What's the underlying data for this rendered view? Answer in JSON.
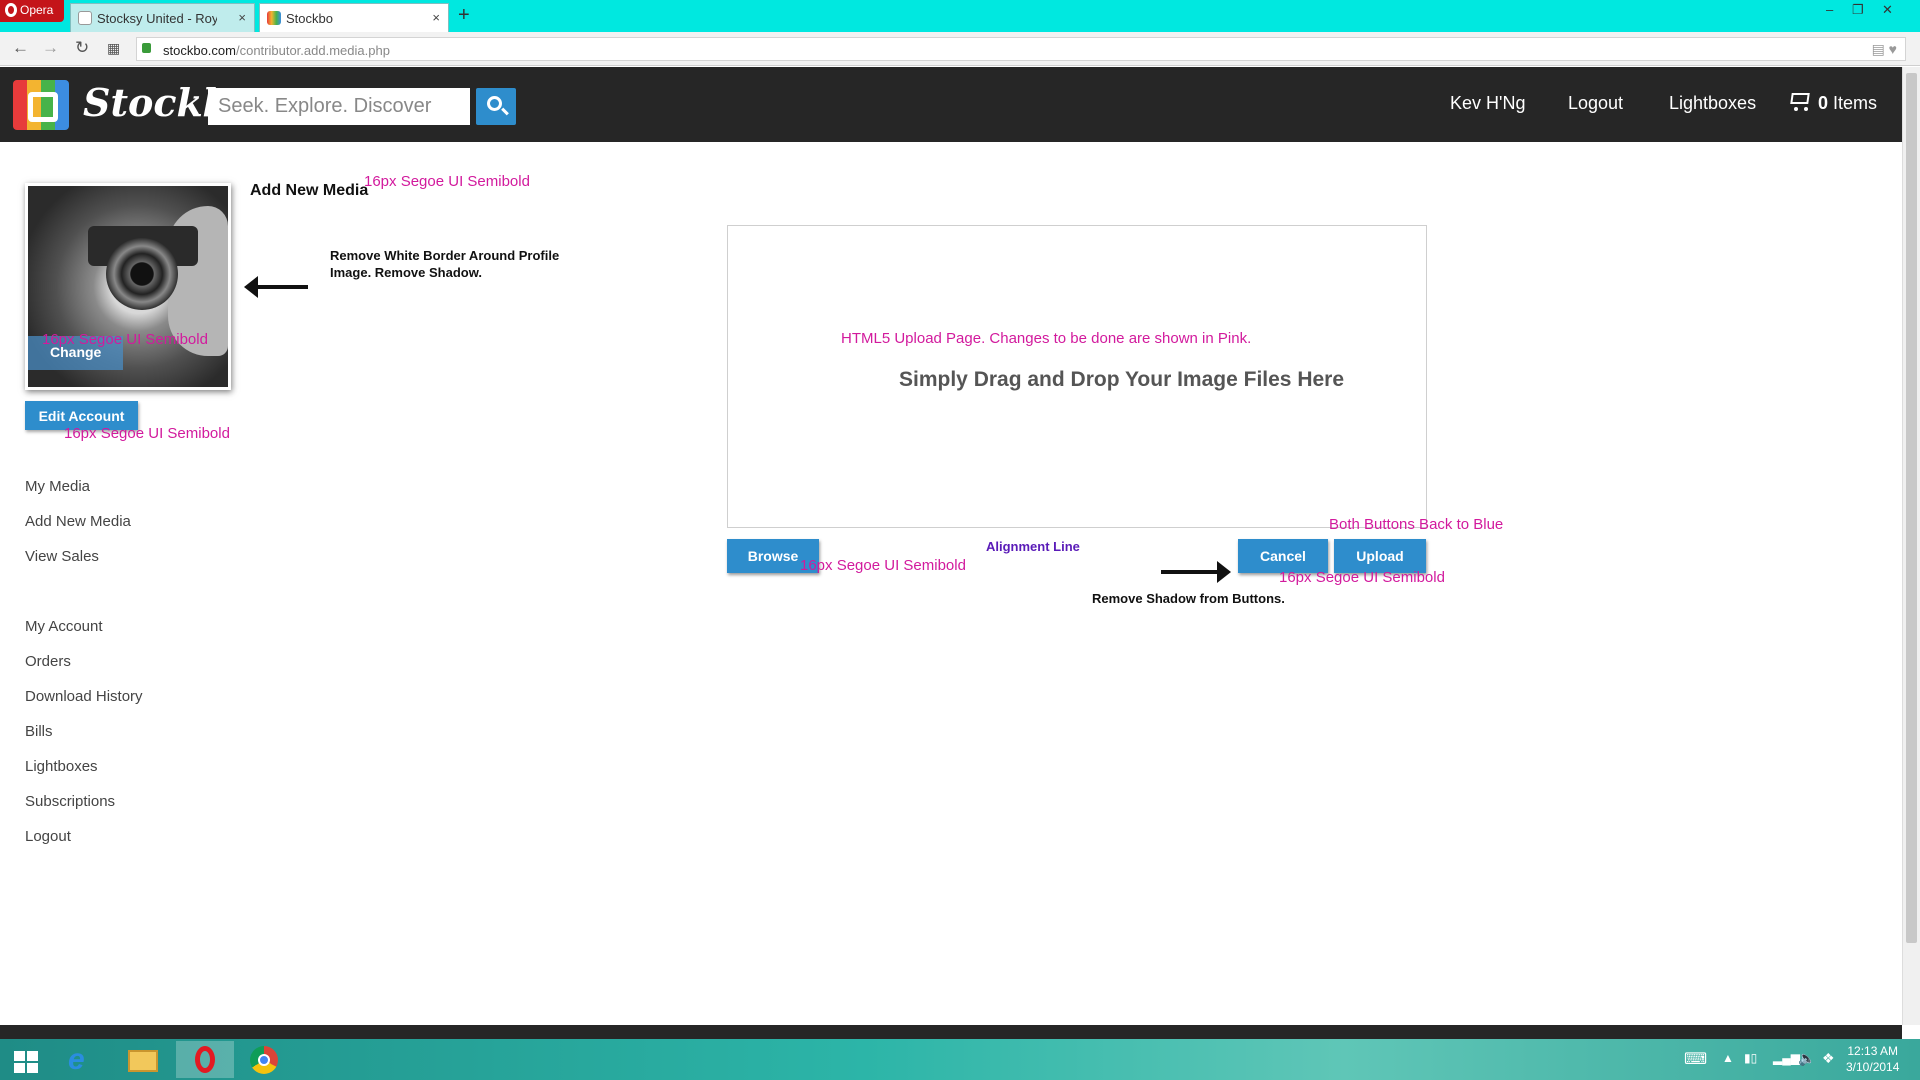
{
  "browser": {
    "opera_label": "Opera",
    "tabs": [
      {
        "title": "Stocksy United - Royalty-F",
        "close": "×"
      },
      {
        "title": "Stockbo",
        "close": "×"
      }
    ],
    "new_tab": "+",
    "url_host": "stockbo.com",
    "url_path": "/contributor.add.media.php",
    "window_controls": {
      "minimize": "–",
      "restore": "❐",
      "close": "✕"
    }
  },
  "header": {
    "logo_text": "Stockbo",
    "search_placeholder": "Seek. Explore. Discover",
    "nav": {
      "user": "Kev H'Ng",
      "logout": "Logout",
      "lightboxes": "Lightboxes"
    },
    "cart": {
      "count": "0",
      "label": "Items"
    }
  },
  "profile": {
    "change_label": "Change",
    "edit_account": "Edit Account"
  },
  "sidebar": {
    "group1": [
      "My Media",
      "Add New Media",
      "View Sales"
    ],
    "group2": [
      "My Account",
      "Orders",
      "Download History",
      "Bills",
      "Lightboxes",
      "Subscriptions",
      "Logout"
    ]
  },
  "main": {
    "title": "Add New Media",
    "drop_text": "Simply Drag and Drop Your Image Files Here",
    "browse": "Browse",
    "cancel": "Cancel",
    "upload": "Upload"
  },
  "annotations": {
    "font_note": "16px Segoe UI Semibold",
    "profile_note_line1": "Remove White Border Around Profile",
    "profile_note_line2": "Image. Remove Shadow.",
    "upload_page_note": "HTML5 Upload Page. Changes to be done are shown in Pink.",
    "buttons_blue": "Both Buttons Back to Blue",
    "alignment_line": "Alignment Line",
    "remove_shadow": "Remove Shadow from Buttons."
  },
  "taskbar": {
    "time": "12:13 AM",
    "date": "3/10/2014"
  },
  "colors": {
    "tab_strip": "#00e8e0",
    "header_bg": "#262626",
    "accent_blue": "#2e8dcc",
    "annotation_pink": "#d21a9d",
    "annotation_purple": "#5a1bb8"
  },
  "icons": [
    "opera-logo-icon",
    "back-arrow-icon",
    "forward-arrow-icon",
    "reload-icon",
    "speed-dial-icon",
    "lock-icon",
    "search-icon",
    "cart-icon",
    "windows-start-icon",
    "ie-icon",
    "file-explorer-icon",
    "opera-icon",
    "chrome-icon",
    "keyboard-icon",
    "network-icon",
    "volume-icon"
  ]
}
